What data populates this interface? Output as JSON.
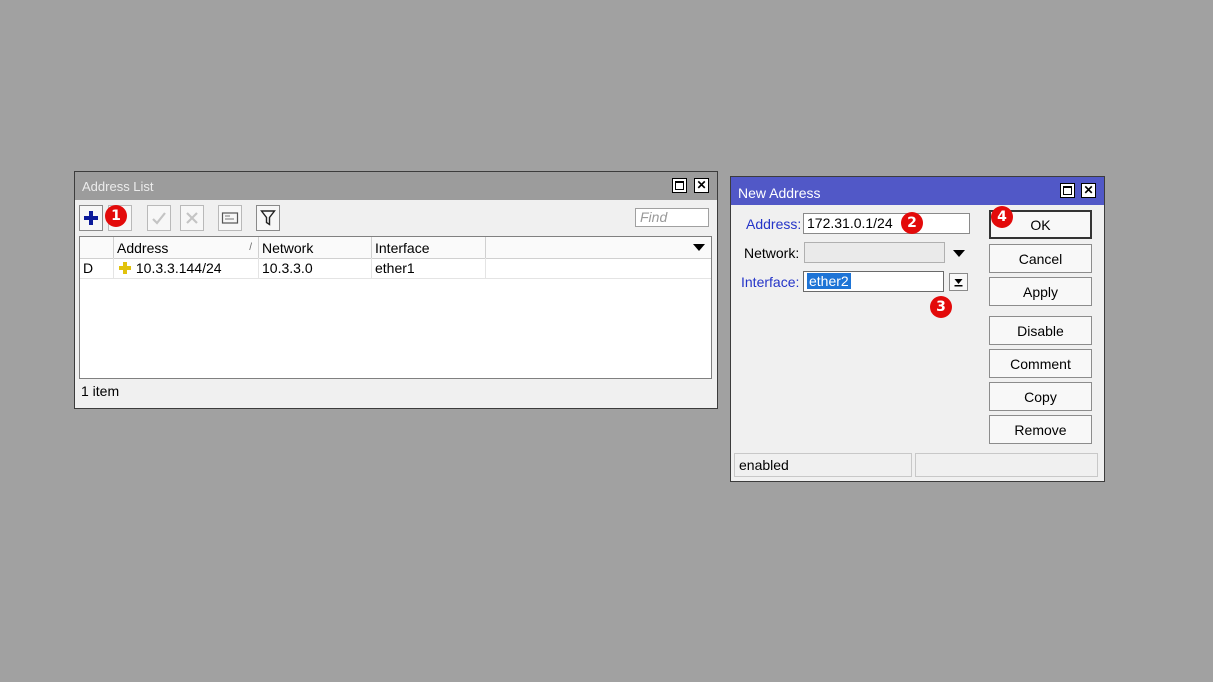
{
  "address_list_window": {
    "title": "Address List",
    "find_placeholder": "Find",
    "columns": [
      "Address",
      "Network",
      "Interface"
    ],
    "sort_indicator": "/",
    "rows": [
      {
        "flag": "D",
        "address": "10.3.3.144/24",
        "network": "10.3.3.0",
        "interface": "ether1"
      }
    ],
    "status": "1 item",
    "toolbar_icons": [
      "add-icon",
      "remove-icon",
      "enable-icon",
      "disable-icon",
      "comment-icon",
      "filter-icon"
    ]
  },
  "new_address_window": {
    "title": "New Address",
    "fields": {
      "address_label": "Address:",
      "address_value": "172.31.0.1/24",
      "network_label": "Network:",
      "network_value": "",
      "interface_label": "Interface:",
      "interface_value": "ether2"
    },
    "buttons": {
      "ok": "OK",
      "cancel": "Cancel",
      "apply": "Apply",
      "disable": "Disable",
      "comment": "Comment",
      "copy": "Copy",
      "remove": "Remove"
    },
    "status": "enabled"
  },
  "callouts": [
    "1",
    "2",
    "3",
    "4"
  ],
  "colors": {
    "background": "#a1a1a1",
    "active_title": "#5158c7",
    "inactive_title": "#9c9c9c",
    "callout": "#e30a0a",
    "selection": "#1e74d6",
    "label_blue": "#2434c8"
  }
}
